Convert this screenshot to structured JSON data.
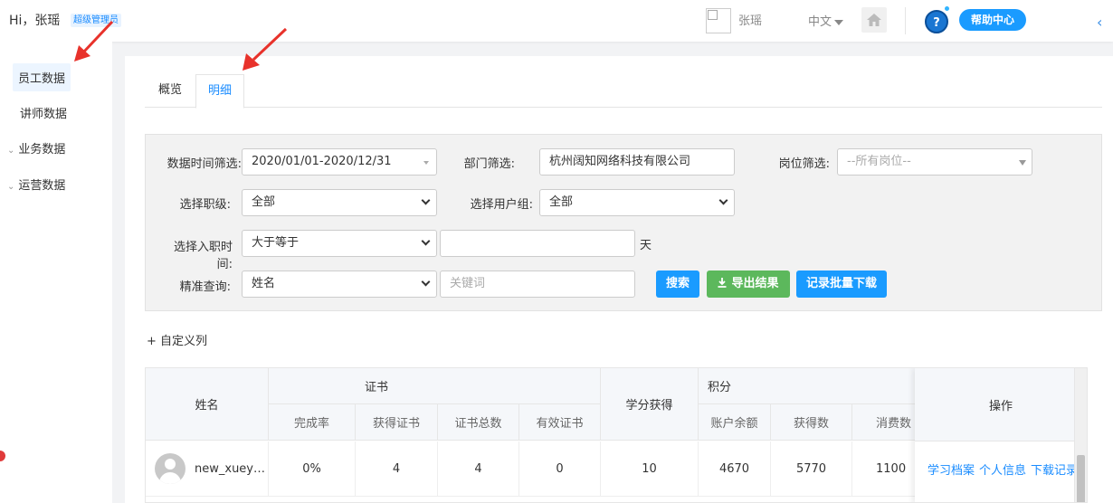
{
  "header": {
    "greeting": "Hi，张瑶",
    "role_badge": "超级管理员",
    "user_name": "张瑶",
    "language": "中文",
    "help_label": "帮助中心",
    "help_q": "?"
  },
  "sidebar": {
    "items": [
      {
        "label": "员工数据"
      },
      {
        "label": "讲师数据"
      },
      {
        "label": "业务数据"
      },
      {
        "label": "运营数据"
      }
    ]
  },
  "tabs": [
    {
      "label": "概览"
    },
    {
      "label": "明细"
    }
  ],
  "filters": {
    "date_label": "数据时间筛选:",
    "date_value": "2020/01/01-2020/12/31",
    "dept_label": "部门筛选:",
    "dept_value": "杭州阔知网络科技有限公司",
    "post_label": "岗位筛选:",
    "post_value": "--所有岗位--",
    "rank_label": "选择职级:",
    "rank_value": "全部",
    "group_label": "选择用户组:",
    "group_value": "全部",
    "hire_label": "选择入职时间:",
    "hire_op": "大于等于",
    "hire_days": "",
    "hire_unit": "天",
    "query_label": "精准查询:",
    "query_field": "姓名",
    "keyword_placeholder": "关键词"
  },
  "buttons": {
    "search": "搜索",
    "export": "导出结果",
    "batch_download": "记录批量下载"
  },
  "custom_columns": "+ 自定义列",
  "table": {
    "headers": {
      "name": "姓名",
      "cert_group": "证书",
      "credit": "学分获得",
      "points_group": "积分",
      "operations": "操作"
    },
    "sub_headers": [
      "完成率",
      "获得证书",
      "证书总数",
      "有效证书",
      "账户余额",
      "获得数",
      "消费数"
    ],
    "rows": [
      {
        "name": "new_xuey…",
        "completion": "0%",
        "certs_obtained": "4",
        "certs_total": "4",
        "certs_valid": "0",
        "credit": "10",
        "balance": "4670",
        "points_gained": "5770",
        "points_spent": "1100",
        "ops": [
          "学习档案",
          "个人信息",
          "下载记录"
        ]
      }
    ]
  }
}
